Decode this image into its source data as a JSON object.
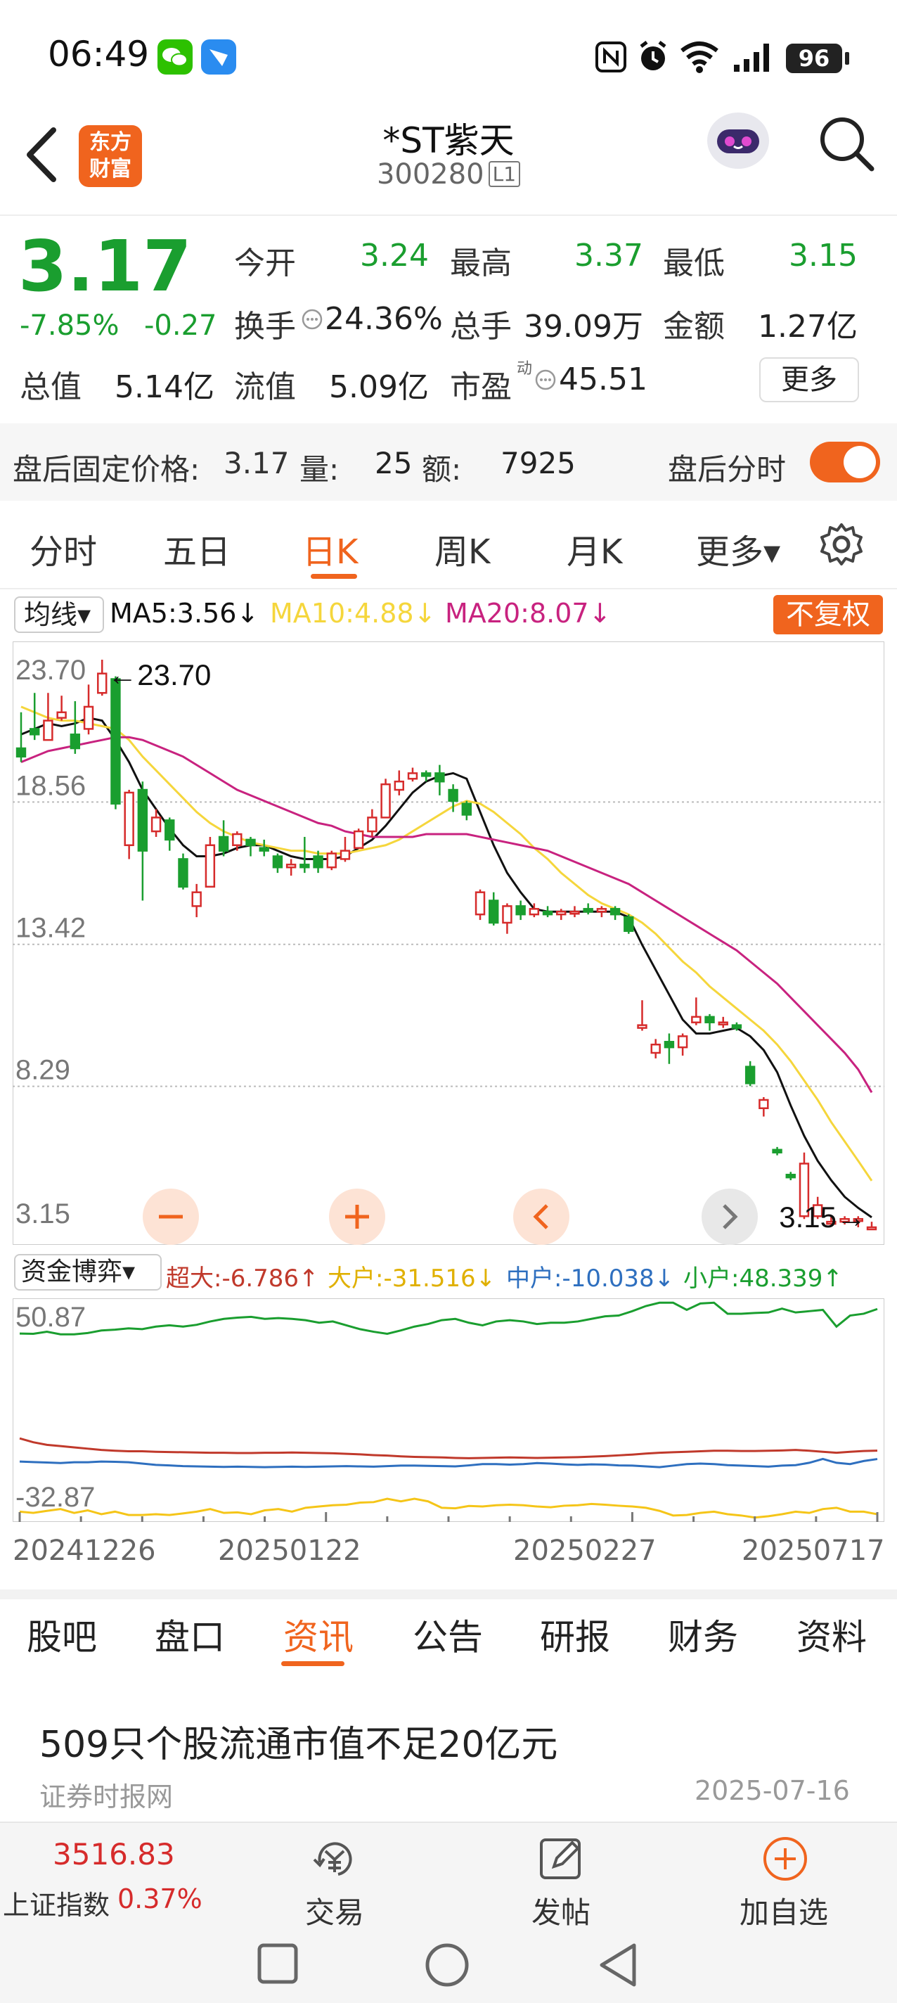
{
  "status": {
    "time": "06:49",
    "battery": "96"
  },
  "header": {
    "logo_line1": "东方",
    "logo_line2": "财富",
    "stock_name": "*ST紫天",
    "stock_code": "300280",
    "level_tag": "L1"
  },
  "quote": {
    "price": "3.17",
    "change_pct": "-7.85%",
    "change": "-0.27",
    "open_label": "今开",
    "open": "3.24",
    "high_label": "最高",
    "high": "3.37",
    "low_label": "最低",
    "low": "3.15",
    "turnover_label": "换手",
    "turnover": "24.36%",
    "volume_label": "总手",
    "volume": "39.09万",
    "amount_label": "金额",
    "amount": "1.27亿",
    "mcap_label": "总值",
    "mcap": "5.14亿",
    "float_label": "流值",
    "float": "5.09亿",
    "pe_label": "市盈",
    "pe_sup": "动",
    "pe": "45.51",
    "more_label": "更多"
  },
  "after_hours": {
    "label": "盘后固定价格:",
    "price": "3.17",
    "vol_label": "量:",
    "vol": "25",
    "amt_label": "额:",
    "amt": "7925",
    "toggle_label": "盘后分时"
  },
  "chart_tabs": [
    "分时",
    "五日",
    "日K",
    "周K",
    "月K",
    "更多▾"
  ],
  "ma": {
    "select": "均线▾",
    "ma5": "MA5:3.56↓",
    "ma10": "MA10:4.88↓",
    "ma20": "MA20:8.07↓",
    "adjust": "不复权"
  },
  "colors": {
    "accent": "#f0641e",
    "up": "#d62b2b",
    "down": "#1a9e2f",
    "ma5": "#111111",
    "ma10": "#f5d63c",
    "ma20": "#c8227f"
  },
  "chart_data": [
    {
      "type": "candlestick",
      "yticks": [
        "23.70",
        "18.56",
        "13.42",
        "8.29",
        "3.15"
      ],
      "ylim": [
        3.15,
        23.7
      ],
      "max_annotation": "←23.70",
      "min_annotation": "3.15→",
      "ohlc": [
        [
          20.5,
          21.8,
          20.2,
          20.0
        ],
        [
          21.2,
          22.5,
          21.0,
          20.8
        ],
        [
          20.8,
          22.5,
          21.5,
          20.8
        ],
        [
          21.6,
          22.4,
          21.8,
          21.5
        ],
        [
          21.0,
          22.2,
          20.5,
          20.3
        ],
        [
          21.2,
          22.8,
          22.0,
          21.0
        ],
        [
          22.5,
          23.7,
          23.2,
          22.4
        ],
        [
          23.0,
          23.1,
          18.5,
          18.3
        ],
        [
          17.0,
          19.0,
          18.9,
          16.5
        ],
        [
          19.0,
          19.3,
          16.8,
          15.0
        ],
        [
          17.5,
          18.3,
          18.0,
          17.3
        ],
        [
          17.9,
          18.0,
          17.2,
          16.8
        ],
        [
          16.5,
          16.7,
          15.5,
          15.4
        ],
        [
          14.8,
          15.6,
          15.3,
          14.4
        ],
        [
          15.5,
          17.3,
          17.0,
          15.5
        ],
        [
          17.3,
          17.9,
          16.8,
          16.6
        ],
        [
          17.0,
          17.5,
          17.4,
          16.8
        ],
        [
          17.2,
          17.3,
          17.0,
          16.6
        ],
        [
          16.9,
          17.2,
          16.8,
          16.6
        ],
        [
          16.6,
          16.7,
          16.2,
          16.0
        ],
        [
          16.2,
          16.5,
          16.3,
          15.9
        ],
        [
          16.3,
          17.3,
          16.2,
          16.0
        ],
        [
          16.6,
          16.8,
          16.2,
          16.0
        ],
        [
          16.2,
          16.8,
          16.7,
          16.1
        ],
        [
          16.5,
          17.3,
          16.8,
          16.4
        ],
        [
          16.9,
          17.6,
          17.5,
          16.9
        ],
        [
          17.5,
          18.3,
          18.0,
          17.3
        ],
        [
          18.0,
          19.4,
          19.2,
          18.0
        ],
        [
          19.0,
          19.7,
          19.3,
          18.8
        ],
        [
          19.4,
          19.8,
          19.6,
          19.3
        ],
        [
          19.6,
          19.7,
          19.5,
          19.3
        ],
        [
          19.6,
          19.9,
          19.3,
          18.8
        ],
        [
          19.0,
          19.2,
          18.6,
          18.2
        ],
        [
          18.5,
          18.6,
          18.1,
          17.9
        ],
        [
          14.5,
          15.4,
          15.3,
          14.3
        ],
        [
          15.0,
          15.3,
          14.2,
          14.1
        ],
        [
          14.2,
          14.9,
          14.8,
          13.8
        ],
        [
          14.8,
          15.0,
          14.5,
          14.3
        ],
        [
          14.5,
          14.9,
          14.7,
          14.4
        ],
        [
          14.6,
          14.8,
          14.5,
          14.4
        ],
        [
          14.5,
          14.7,
          14.6,
          14.3
        ],
        [
          14.6,
          14.8,
          14.6,
          14.4
        ],
        [
          14.7,
          14.9,
          14.6,
          14.5
        ],
        [
          14.6,
          14.8,
          14.7,
          14.4
        ],
        [
          14.7,
          14.8,
          14.5,
          14.3
        ],
        [
          14.4,
          14.5,
          13.9,
          13.8
        ],
        [
          10.4,
          11.4,
          10.5,
          10.3
        ],
        [
          9.5,
          10.0,
          9.8,
          9.3
        ],
        [
          9.9,
          10.2,
          9.7,
          9.1
        ],
        [
          9.7,
          10.2,
          10.1,
          9.4
        ],
        [
          10.6,
          11.5,
          10.8,
          10.5
        ],
        [
          10.8,
          10.9,
          10.6,
          10.3
        ],
        [
          10.6,
          10.8,
          10.6,
          10.4
        ],
        [
          10.5,
          10.6,
          10.4,
          10.3
        ],
        [
          9.0,
          9.2,
          8.4,
          8.3
        ],
        [
          7.5,
          7.9,
          7.8,
          7.2
        ],
        [
          6.0,
          6.1,
          5.9,
          5.8
        ],
        [
          5.1,
          5.2,
          5.0,
          4.9
        ],
        [
          3.6,
          5.9,
          5.5,
          3.5
        ],
        [
          3.6,
          4.3,
          4.0,
          3.5
        ],
        [
          3.4,
          3.6,
          3.4,
          3.3
        ],
        [
          3.4,
          3.6,
          3.5,
          3.3
        ],
        [
          3.5,
          3.6,
          3.5,
          3.2
        ],
        [
          3.2,
          3.4,
          3.2,
          3.15
        ]
      ],
      "ma5": [
        21.0,
        21.2,
        21.4,
        21.3,
        21.4,
        21.6,
        21.5,
        20.8,
        20.0,
        19.0,
        18.3,
        17.6,
        17.0,
        16.6,
        16.6,
        16.7,
        16.9,
        17.0,
        17.0,
        16.8,
        16.6,
        16.5,
        16.5,
        16.5,
        16.6,
        16.9,
        17.2,
        17.7,
        18.3,
        18.9,
        19.3,
        19.5,
        19.6,
        19.4,
        18.2,
        17.0,
        16.0,
        15.3,
        14.7,
        14.6,
        14.6,
        14.6,
        14.6,
        14.6,
        14.6,
        14.4,
        13.4,
        12.5,
        11.6,
        10.7,
        10.2,
        10.2,
        10.3,
        10.4,
        10.1,
        9.6,
        8.8,
        7.6,
        6.5,
        5.6,
        4.9,
        4.3,
        3.9,
        3.56
      ],
      "ma10": [
        22.0,
        21.8,
        21.6,
        21.5,
        21.5,
        21.4,
        21.3,
        21.2,
        20.8,
        20.2,
        19.7,
        19.2,
        18.7,
        18.2,
        17.8,
        17.5,
        17.3,
        17.1,
        17.0,
        16.9,
        16.8,
        16.8,
        16.7,
        16.7,
        16.7,
        16.8,
        16.9,
        17.0,
        17.2,
        17.5,
        17.8,
        18.1,
        18.4,
        18.6,
        18.5,
        18.2,
        17.8,
        17.4,
        16.9,
        16.5,
        16.0,
        15.6,
        15.2,
        14.9,
        14.7,
        14.5,
        14.2,
        13.8,
        13.3,
        12.8,
        12.4,
        11.9,
        11.5,
        11.1,
        10.7,
        10.3,
        9.8,
        9.2,
        8.5,
        7.8,
        7.0,
        6.3,
        5.6,
        4.88
      ],
      "ma20": [
        20.0,
        20.2,
        20.4,
        20.5,
        20.6,
        20.7,
        20.8,
        20.9,
        20.9,
        20.8,
        20.6,
        20.4,
        20.2,
        19.9,
        19.6,
        19.3,
        19.0,
        18.8,
        18.6,
        18.4,
        18.2,
        18.0,
        17.8,
        17.7,
        17.5,
        17.4,
        17.3,
        17.3,
        17.3,
        17.3,
        17.4,
        17.4,
        17.4,
        17.4,
        17.3,
        17.2,
        17.1,
        17.0,
        16.9,
        16.8,
        16.6,
        16.4,
        16.2,
        16.0,
        15.8,
        15.6,
        15.3,
        15.0,
        14.7,
        14.4,
        14.1,
        13.8,
        13.5,
        13.2,
        12.8,
        12.4,
        12.0,
        11.5,
        11.0,
        10.5,
        10.0,
        9.5,
        8.9,
        8.07
      ]
    },
    {
      "type": "line",
      "yticks": [
        "50.87",
        "-32.87"
      ],
      "ylim": [
        -32.87,
        50.87
      ],
      "x": [
        "20241226",
        "20250122",
        "20250227",
        "20250717"
      ],
      "series": [
        {
          "name": "超大",
          "label": "超大:-6.786↑",
          "color": "#c0392b",
          "values": [
            -2.0,
            -3.5,
            -4.5,
            -5.0,
            -5.5,
            -6.0,
            -6.5,
            -6.8,
            -7.0,
            -7.0,
            -7.2,
            -7.3,
            -7.4,
            -7.5,
            -7.6,
            -7.6,
            -7.7,
            -7.7,
            -7.6,
            -7.6,
            -7.5,
            -7.6,
            -7.7,
            -7.8,
            -8.0,
            -8.2,
            -8.5,
            -8.7,
            -9.0,
            -9.2,
            -9.3,
            -9.4,
            -9.6,
            -9.7,
            -9.6,
            -9.5,
            -9.4,
            -9.5,
            -9.6,
            -9.5,
            -9.4,
            -9.3,
            -9.1,
            -8.9,
            -8.6,
            -8.3,
            -7.9,
            -7.6,
            -7.4,
            -7.2,
            -7.0,
            -6.8,
            -6.8,
            -6.9,
            -6.9,
            -6.8,
            -6.7,
            -6.5,
            -6.8,
            -7.2,
            -7.6,
            -7.2,
            -6.9,
            -6.786
          ]
        },
        {
          "name": "大户",
          "label": "大户:-31.516↓",
          "color": "#f5c518",
          "values": [
            -30.5,
            -31.0,
            -30.2,
            -29.5,
            -31.0,
            -30.0,
            -31.5,
            -30.5,
            -31.8,
            -31.8,
            -31.5,
            -31.8,
            -31.2,
            -30.5,
            -29.5,
            -31.0,
            -30.8,
            -31.5,
            -30.0,
            -29.5,
            -30.5,
            -29.0,
            -28.5,
            -28.0,
            -27.8,
            -27.0,
            -26.8,
            -25.5,
            -26.5,
            -25.5,
            -26.5,
            -29.0,
            -29.2,
            -28.3,
            -28.5,
            -28.0,
            -27.8,
            -28.0,
            -28.5,
            -28.8,
            -28.2,
            -28.0,
            -27.5,
            -27.8,
            -28.2,
            -28.5,
            -29.0,
            -30.2,
            -32.0,
            -31.8,
            -31.0,
            -30.5,
            -31.5,
            -32.0,
            -32.8,
            -32.3,
            -31.5,
            -30.5,
            -31.0,
            -29.5,
            -29.0,
            -30.5,
            -30.5,
            -31.516
          ]
        },
        {
          "name": "中户",
          "label": "中户:-10.038↓",
          "color": "#2e6fbf",
          "values": [
            -11.0,
            -11.2,
            -11.4,
            -11.6,
            -11.3,
            -11.3,
            -11.0,
            -11.1,
            -11.3,
            -11.8,
            -12.3,
            -12.5,
            -12.8,
            -12.9,
            -13.0,
            -13.1,
            -13.0,
            -13.1,
            -13.2,
            -13.1,
            -13.0,
            -13.1,
            -13.0,
            -12.9,
            -12.8,
            -12.9,
            -13.0,
            -12.8,
            -12.6,
            -12.6,
            -12.7,
            -12.8,
            -12.9,
            -12.5,
            -12.0,
            -12.0,
            -12.2,
            -12.0,
            -11.6,
            -11.8,
            -12.1,
            -12.3,
            -12.1,
            -12.2,
            -12.5,
            -12.6,
            -12.9,
            -13.2,
            -12.6,
            -12.0,
            -11.8,
            -12.0,
            -12.4,
            -12.6,
            -12.8,
            -13.0,
            -12.6,
            -12.4,
            -11.5,
            -10.0,
            -11.5,
            -12.0,
            -10.8,
            -10.038
          ]
        },
        {
          "name": "小户",
          "label": "小户:48.339↑",
          "color": "#1a9e2f",
          "values": [
            38.8,
            38.7,
            39.5,
            38.5,
            38.5,
            39.0,
            40.0,
            40.3,
            40.8,
            40.5,
            41.5,
            42.0,
            41.5,
            42.2,
            43.5,
            44.5,
            45.0,
            45.3,
            44.5,
            44.8,
            44.5,
            44.0,
            43.0,
            43.5,
            42.0,
            40.5,
            39.5,
            38.7,
            40.0,
            41.5,
            42.5,
            44.0,
            44.5,
            43.0,
            42.0,
            43.5,
            44.0,
            43.5,
            42.5,
            43.0,
            43.0,
            43.5,
            44.5,
            45.5,
            45.8,
            47.5,
            49.5,
            50.8,
            50.8,
            48.0,
            50.5,
            50.8,
            46.5,
            46.5,
            46.8,
            47.0,
            48.5,
            47.0,
            47.5,
            48.0,
            41.5,
            45.8,
            46.5,
            48.339
          ]
        }
      ]
    }
  ],
  "flow": {
    "select": "资金博弈▾"
  },
  "info_tabs": [
    "股吧",
    "盘口",
    "资讯",
    "公告",
    "研报",
    "财务",
    "资料"
  ],
  "news": {
    "title": "509只个股流通市值不足20亿元",
    "source": "证券时报网",
    "date": "2025-07-16"
  },
  "bottom_bar": {
    "index_value": "3516.83",
    "index_label": "上证指数",
    "index_pct": "0.37%",
    "trade": "交易",
    "post": "发帖",
    "add_watch": "加自选"
  }
}
